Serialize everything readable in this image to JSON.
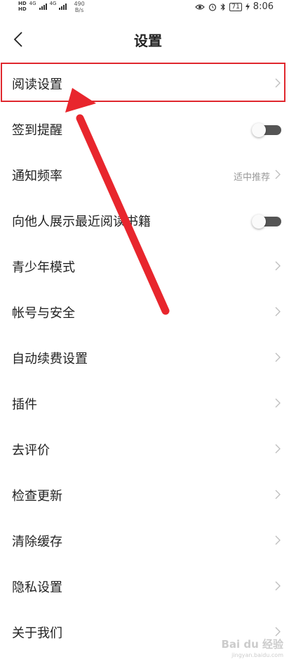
{
  "status_bar": {
    "sim1": "HD",
    "sim2": "HD",
    "network1": "4G",
    "network2": "4G",
    "net_speed": "490",
    "net_speed_unit": "B/s",
    "battery": "71",
    "time": "8:06"
  },
  "header": {
    "title": "设置"
  },
  "settings": {
    "items": [
      {
        "label": "阅读设置"
      },
      {
        "label": "签到提醒",
        "toggle": false
      },
      {
        "label": "通知频率",
        "value": "适中推荐"
      },
      {
        "label": "向他人展示最近阅读书籍",
        "toggle": false
      },
      {
        "label": "青少年模式"
      },
      {
        "label": "帐号与安全"
      },
      {
        "label": "自动续费设置"
      },
      {
        "label": "插件"
      },
      {
        "label": "去评价"
      },
      {
        "label": "检查更新"
      },
      {
        "label": "清除缓存"
      },
      {
        "label": "隐私设置"
      },
      {
        "label": "关于我们"
      }
    ]
  },
  "annotation": {
    "color": "#e0282e"
  },
  "watermark": {
    "text": "Bai du 经验",
    "sub": "jingyan.baidu.com"
  }
}
